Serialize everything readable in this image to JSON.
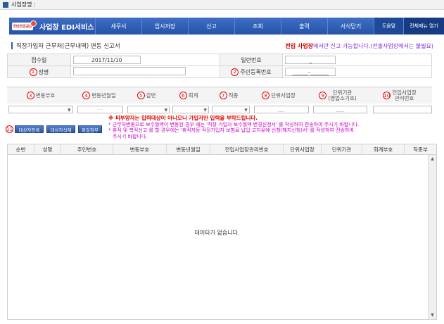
{
  "window": {
    "title": "사업장명 :"
  },
  "nav": {
    "logo_text": "국민연금공단",
    "brand": "사업장 EDI서비스",
    "items": [
      "세무서",
      "임시저장",
      "신고",
      "조회",
      "출력",
      "서식닫기"
    ],
    "help": "도움말",
    "all_menu": "전체메뉴 열기"
  },
  "page": {
    "title": "직장가입자 근무처(근무내역) 변동 신고서",
    "notice_strong": "전입 사업장",
    "notice_rest": "에서만 신고 가능합니다.(전출사업장에서는 불필요)"
  },
  "form": {
    "receipt_date_label": "접수일",
    "receipt_date_value": "2017/11/10",
    "serial_label": "일련번호",
    "serial_value": "_",
    "name_num": "1",
    "name_label": "성명",
    "name_value": "",
    "rrn_num": "2",
    "rrn_label": "주민등록번호",
    "rrn_value": "______-_______"
  },
  "columns": [
    {
      "num": "3",
      "label": "변동부호"
    },
    {
      "num": "4",
      "label": "변동년월일"
    },
    {
      "num": "5",
      "label": "감면"
    },
    {
      "num": "6",
      "label": "회계"
    },
    {
      "num": "7",
      "label": "직종"
    },
    {
      "num": "8",
      "label": "단위사업장"
    },
    {
      "num": "9",
      "label": "단위기관\n(영업소기호)"
    },
    {
      "num": "10",
      "label": "전입사업장\n관리번호"
    }
  ],
  "field_values": {
    "date": "- -",
    "unit": "___",
    "office": "____"
  },
  "buttons": {
    "num": "11",
    "register": "대상자등록",
    "delete": "대상자삭제",
    "attach": "파일첨부"
  },
  "warnings": {
    "line1": "※ 피부양자는 입력대상이 아니오니 가입자만 입력을 부탁드립니다.",
    "line2": "* 근무처변동으로 보수월액이 변동된 경우 에는 '직장 가입자 보수월액 변경신청서' 를 작성하여 전송하여 주시기 바랍니다.",
    "line3": "* 휴직 및 복직신고 를 할 경우에는 '휴직자등 직장가입자 보험료 납입 고지유예 신청(해지신청)서' 를 작성하여 전송하여",
    "line4": "주시기 바랍니다."
  },
  "grid": {
    "headers": [
      "순번",
      "성명",
      "주민번호",
      "변동부호",
      "변동년월일",
      "전입사업장관리번호",
      "단위사업장",
      "단위기관",
      "회계부호",
      "직종부"
    ],
    "empty_message": "데이타가 없습니다."
  }
}
